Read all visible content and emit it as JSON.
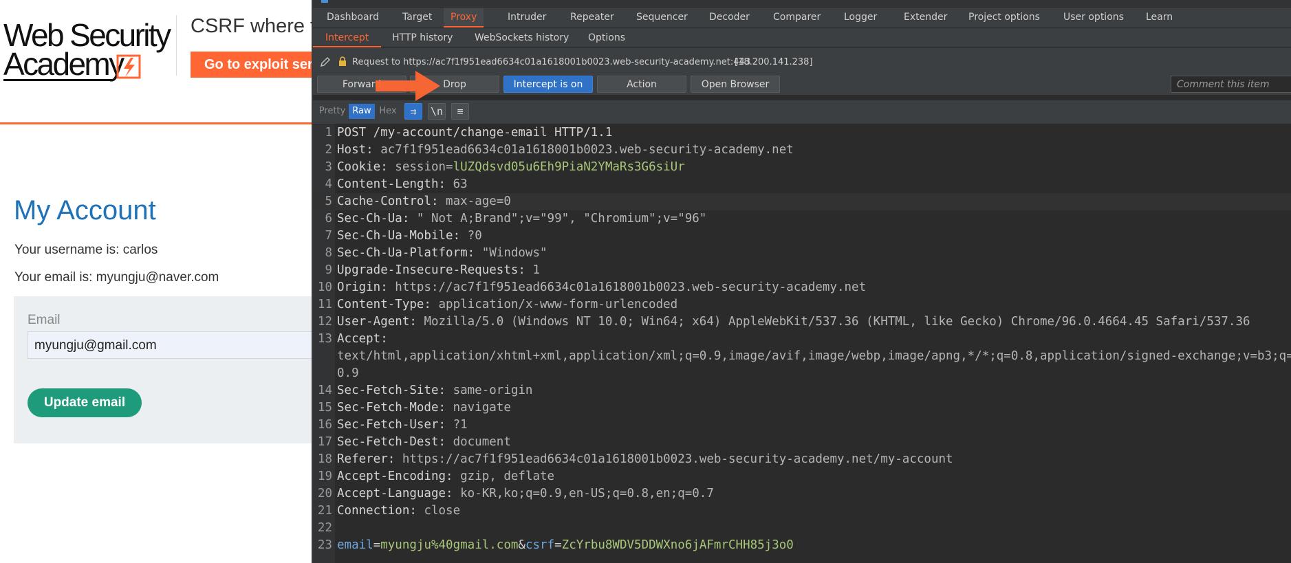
{
  "academy": {
    "logo_line1": "Web Security",
    "logo_line2": "Academy",
    "lab_title": "CSRF where token validation depends on request method",
    "exploit_button": "Go to exploit server",
    "heading": "My Account",
    "username_text": "Your username is: carlos",
    "email_text": "Your email is: myungju@naver.com",
    "email_label": "Email",
    "email_value": "myungju@gmail.com",
    "update_button": "Update email"
  },
  "burp": {
    "main_tabs": [
      "Dashboard",
      "Target",
      "Proxy",
      "Intruder",
      "Repeater",
      "Sequencer",
      "Decoder",
      "Comparer",
      "Logger",
      "Extender",
      "Project options",
      "User options",
      "Learn"
    ],
    "active_main_tab": "Proxy",
    "sub_tabs": [
      "Intercept",
      "HTTP history",
      "WebSockets history",
      "Options"
    ],
    "active_sub_tab": "Intercept",
    "request_to": "Request to https://ac7f1f951ead6634c01a1618001b0023.web-security-academy.net:443",
    "request_ip": "[18.200.141.238]",
    "buttons": {
      "forward": "Forward",
      "drop": "Drop",
      "intercept": "Intercept is on",
      "action": "Action",
      "open_browser": "Open Browser"
    },
    "comment_placeholder": "Comment this item",
    "view_modes": [
      "Pretty",
      "Raw",
      "Hex"
    ],
    "active_view_mode": "Raw",
    "newline_toggle": "\\n",
    "request_lines": [
      {
        "n": "1",
        "k": "POST /my-account/change-email HTTP/1.1",
        "v": ""
      },
      {
        "n": "2",
        "k": "Host: ",
        "v": "ac7f1f951ead6634c01a1618001b0023.web-security-academy.net"
      },
      {
        "n": "3",
        "k": "Cookie: ",
        "v": "session=",
        "c": "lUZQdsvd05u6Eh9PiaN2YMaRs3G6siUr"
      },
      {
        "n": "4",
        "k": "Content-Length: ",
        "v": "63"
      },
      {
        "n": "5",
        "k": "Cache-Control: ",
        "v": "max-age=0"
      },
      {
        "n": "6",
        "k": "Sec-Ch-Ua: ",
        "v": "\" Not A;Brand\";v=\"99\", \"Chromium\";v=\"96\""
      },
      {
        "n": "7",
        "k": "Sec-Ch-Ua-Mobile: ",
        "v": "?0"
      },
      {
        "n": "8",
        "k": "Sec-Ch-Ua-Platform: ",
        "v": "\"Windows\""
      },
      {
        "n": "9",
        "k": "Upgrade-Insecure-Requests: ",
        "v": "1"
      },
      {
        "n": "10",
        "k": "Origin: ",
        "v": "https://ac7f1f951ead6634c01a1618001b0023.web-security-academy.net"
      },
      {
        "n": "11",
        "k": "Content-Type: ",
        "v": "application/x-www-form-urlencoded"
      },
      {
        "n": "12",
        "k": "User-Agent: ",
        "v": "Mozilla/5.0 (Windows NT 10.0; Win64; x64) AppleWebKit/537.36 (KHTML, like Gecko) Chrome/96.0.4664.45 Safari/537.36"
      },
      {
        "n": "13",
        "k": "Accept: ",
        "v": ""
      },
      {
        "n": "",
        "k": "",
        "v": "text/html,application/xhtml+xml,application/xml;q=0.9,image/avif,image/webp,image/apng,*/*;q=0.8,application/signed-exchange;v=b3;q="
      },
      {
        "n": "",
        "k": "",
        "v": "0.9"
      },
      {
        "n": "14",
        "k": "Sec-Fetch-Site: ",
        "v": "same-origin"
      },
      {
        "n": "15",
        "k": "Sec-Fetch-Mode: ",
        "v": "navigate"
      },
      {
        "n": "16",
        "k": "Sec-Fetch-User: ",
        "v": "?1"
      },
      {
        "n": "17",
        "k": "Sec-Fetch-Dest: ",
        "v": "document"
      },
      {
        "n": "18",
        "k": "Referer: ",
        "v": "https://ac7f1f951ead6634c01a1618001b0023.web-security-academy.net/my-account"
      },
      {
        "n": "19",
        "k": "Accept-Encoding: ",
        "v": "gzip, deflate"
      },
      {
        "n": "20",
        "k": "Accept-Language: ",
        "v": "ko-KR,ko;q=0.9,en-US;q=0.8,en;q=0.7"
      },
      {
        "n": "21",
        "k": "Connection: ",
        "v": "close"
      },
      {
        "n": "22",
        "k": "",
        "v": ""
      }
    ],
    "body_params": [
      {
        "name": "email",
        "value": "myungju%40gmail.com"
      },
      {
        "name": "csrf",
        "value": "ZcYrbu8WDV5DDWXno6jAFmrCHH85j3o0"
      }
    ],
    "body_line_number": "23"
  },
  "colors": {
    "orange": "#ff6633",
    "academy_blue": "#1e72b8",
    "update_green": "#1e9b7a",
    "burp_bg": "#2b2b2b",
    "burp_blue": "#2f72c7",
    "annotation_arrow": "#ff6633"
  }
}
